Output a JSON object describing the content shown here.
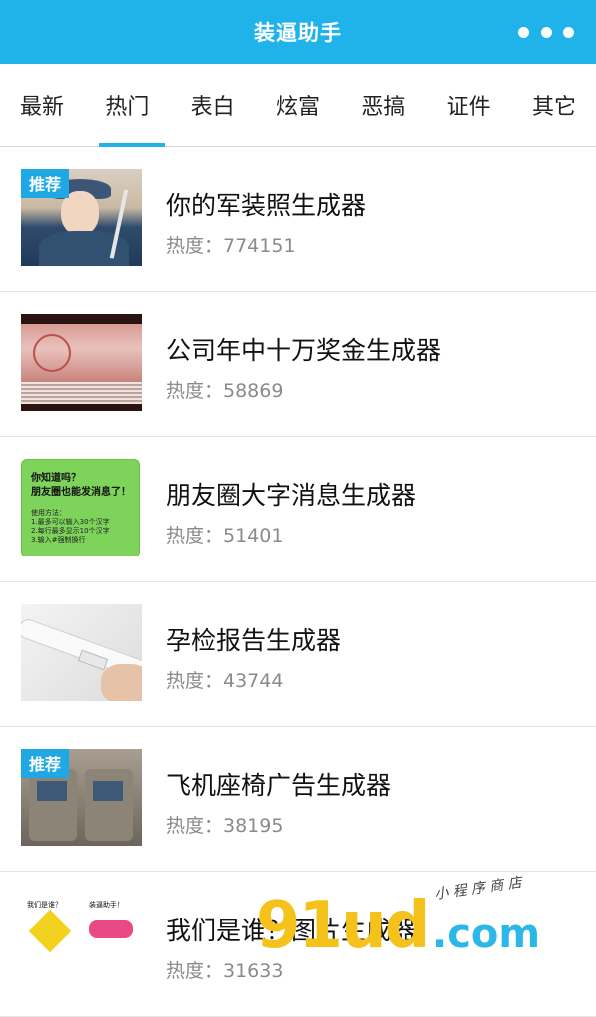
{
  "header": {
    "title": "装逼助手"
  },
  "tabs": [
    {
      "label": "最新"
    },
    {
      "label": "热门",
      "active": true
    },
    {
      "label": "表白"
    },
    {
      "label": "炫富"
    },
    {
      "label": "恶搞"
    },
    {
      "label": "证件"
    },
    {
      "label": "其它"
    }
  ],
  "items": [
    {
      "name": "你的军装照生成器",
      "heat": "热度：774151",
      "badge": "推荐"
    },
    {
      "name": "公司年中十万奖金生成器",
      "heat": "热度：58869"
    },
    {
      "name": "朋友圈大字消息生成器",
      "heat": "热度：51401",
      "thumb_text": {
        "l1": "你知道吗？",
        "l2": "朋友圈也能发消息了！",
        "l3": "使用方法：\n1.最多可以输入30个汉字\n2.每行最多显示10个汉字\n3.输入#强制换行"
      }
    },
    {
      "name": "孕检报告生成器",
      "heat": "热度：43744"
    },
    {
      "name": "飞机座椅广告生成器",
      "heat": "热度：38195",
      "badge": "推荐"
    },
    {
      "name": "我们是谁？图片生成器",
      "heat": "热度：31633",
      "thumb_text": {
        "cap1": "我们是谁？",
        "cap2": "装逼助手！"
      }
    }
  ],
  "watermark": {
    "main": "91ud",
    "domain": ".com",
    "tagline": "小 程 序 商 店"
  },
  "colors": {
    "accent": "#1fb3ea",
    "badge": "#1fa8e4"
  }
}
